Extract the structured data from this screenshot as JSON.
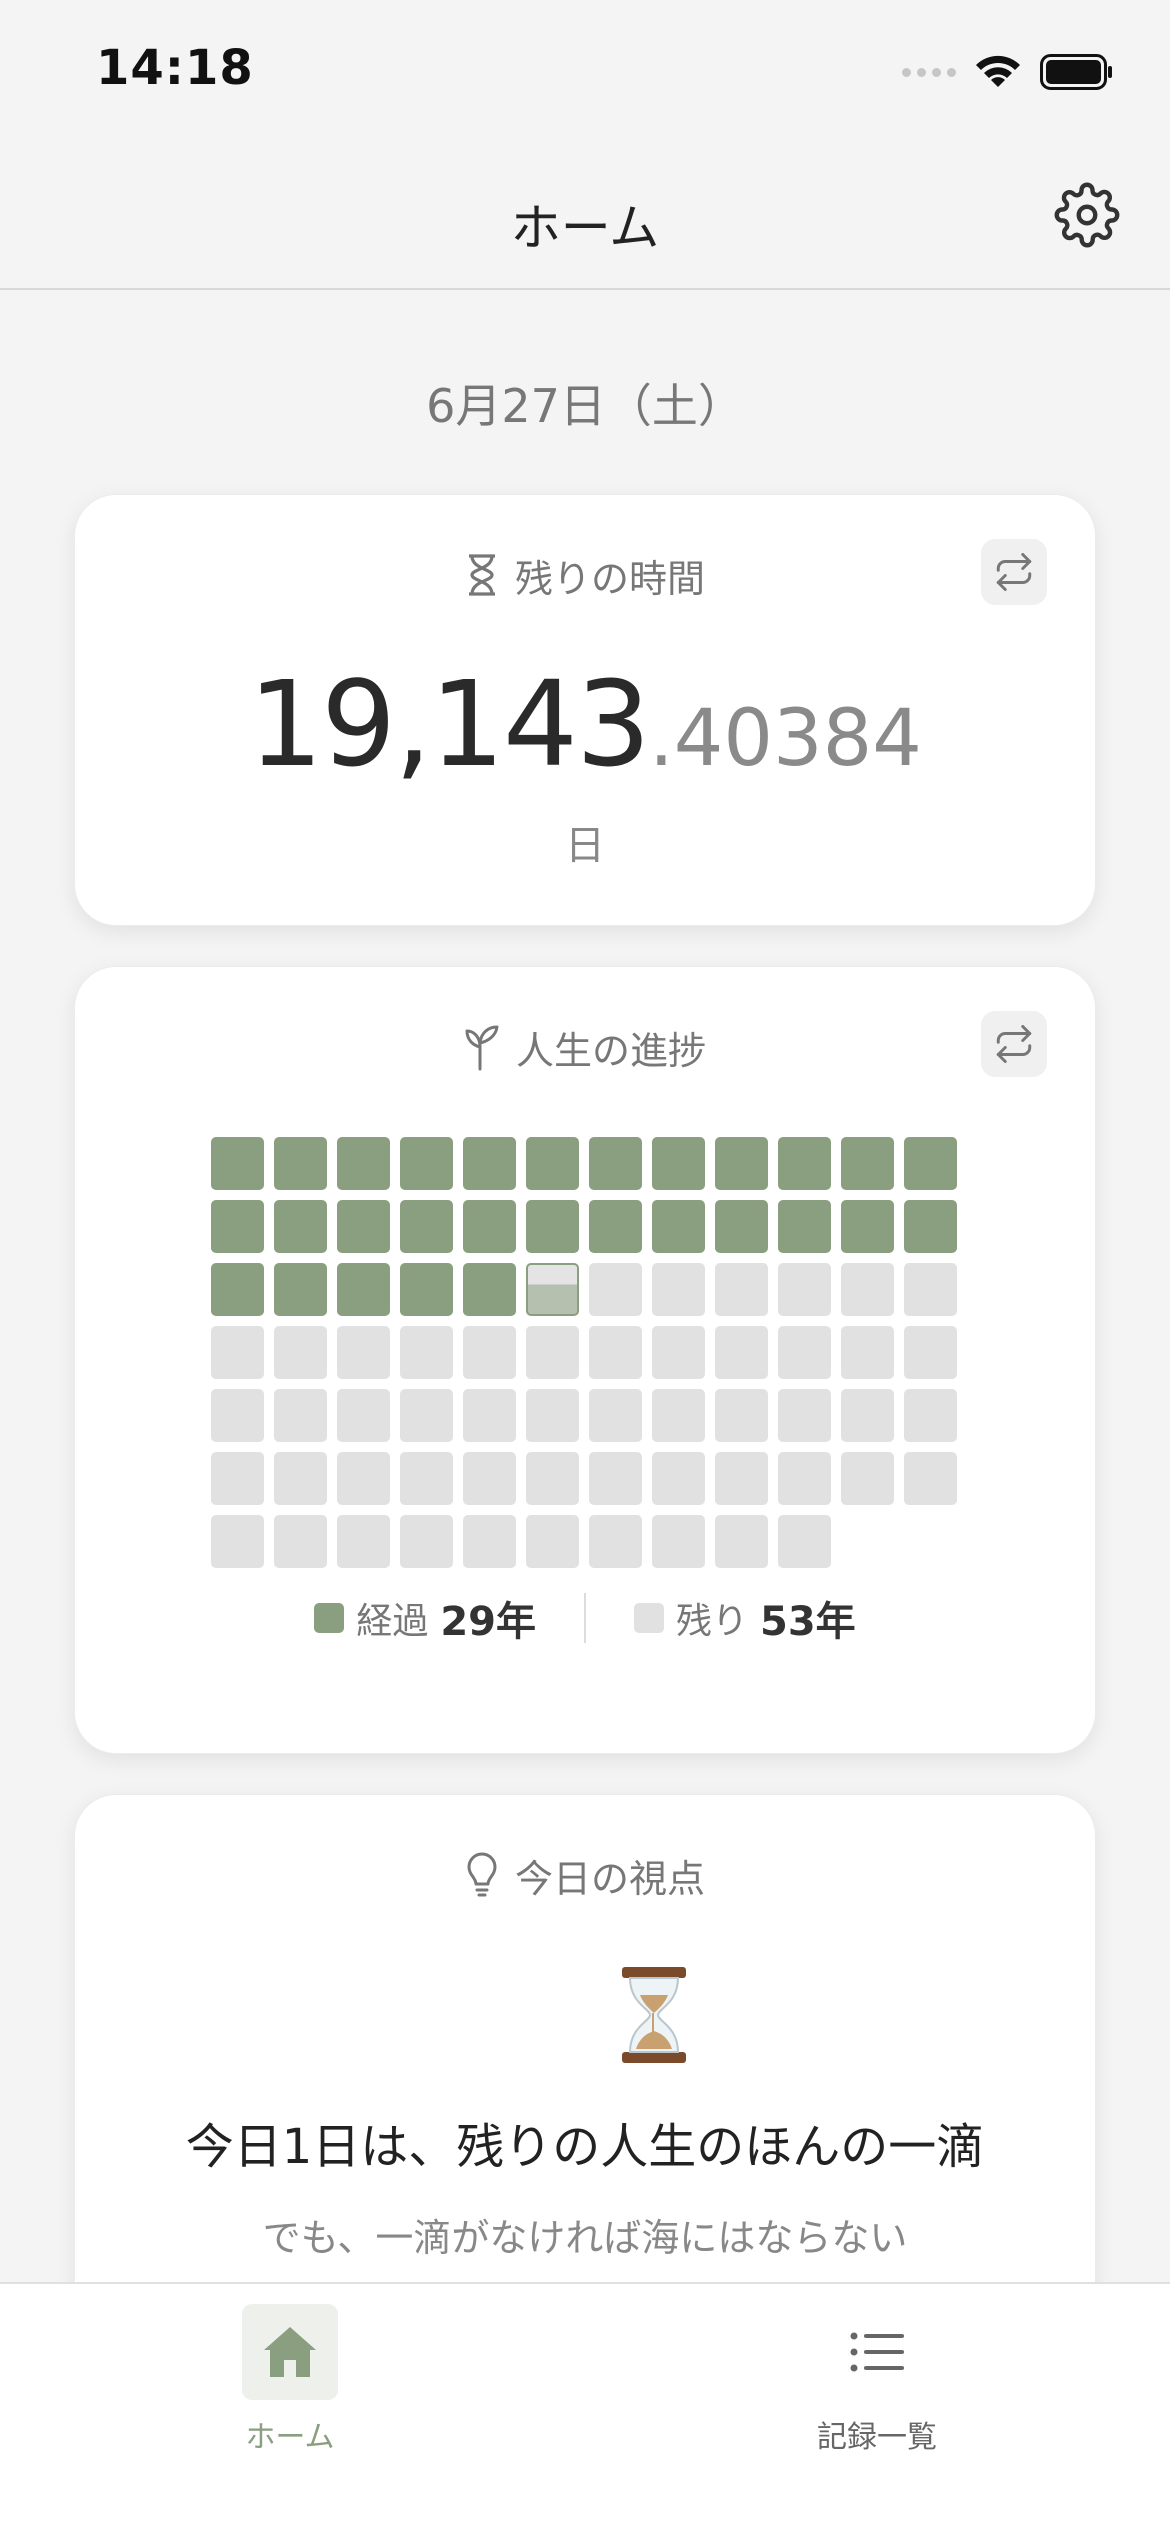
{
  "status_bar": {
    "time": "14:18"
  },
  "nav": {
    "title": "ホーム",
    "settings_icon": "gear-icon"
  },
  "date": "6月27日（土）",
  "remaining_card": {
    "title": "残りの時間",
    "icon": "hourglass-icon",
    "swap_icon": "swap-icon",
    "days_integer": "19,143",
    "days_fraction": ".40384",
    "unit": "日"
  },
  "progress_card": {
    "title": "人生の進捗",
    "icon": "sprout-icon",
    "swap_icon": "swap-icon",
    "total_years": 82,
    "elapsed_years": 29,
    "current_year_fraction": 0.6,
    "legend": {
      "elapsed_label": "経過",
      "elapsed_value": "29年",
      "remaining_label": "残り",
      "remaining_value": "53年"
    },
    "colors": {
      "elapsed": "#8a9e80",
      "remaining": "#e1e1e1"
    }
  },
  "perspective_card": {
    "title": "今日の視点",
    "icon": "lightbulb-icon",
    "emoji": "hourglass-emoji",
    "quote": "今日1日は、残りの人生のほんの一滴",
    "sub": "でも、一滴がなければ海にはならない"
  },
  "tab_bar": {
    "items": [
      {
        "label": "ホーム",
        "icon": "home-icon",
        "active": true
      },
      {
        "label": "記録一覧",
        "icon": "list-icon",
        "active": false
      }
    ]
  },
  "accent_color": "#8a9e80"
}
